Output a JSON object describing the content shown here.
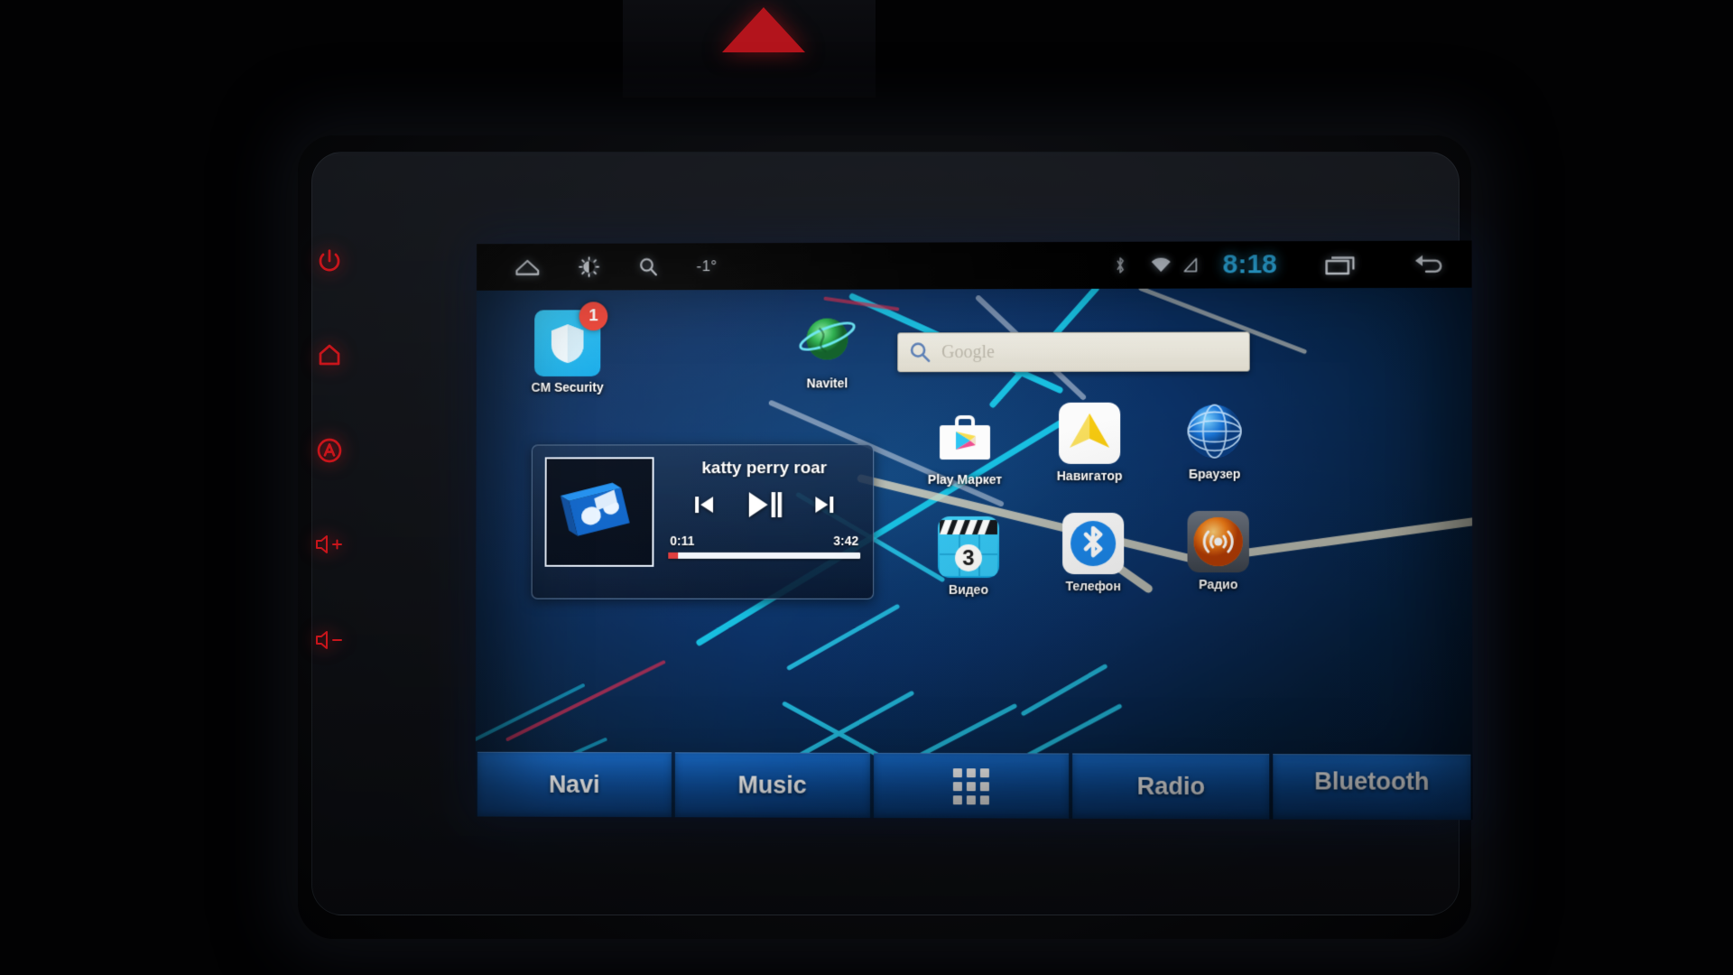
{
  "device": {
    "type": "android-car-head-unit",
    "side_keys": [
      {
        "name": "power-key",
        "glyph": "power"
      },
      {
        "name": "home-key",
        "glyph": "home"
      },
      {
        "name": "mode-key",
        "glyph": "mode-a"
      },
      {
        "name": "volume-up-key",
        "glyph": "volume-up",
        "label": "+"
      },
      {
        "name": "volume-down-key",
        "glyph": "volume-down",
        "label": "-"
      }
    ]
  },
  "status_bar": {
    "home_icon": "home-icon",
    "brightness_icon": "brightness-icon",
    "search_icon": "search-icon",
    "temperature": "-1°",
    "bluetooth_icon": "bluetooth-icon",
    "wifi_icon": "wifi-icon",
    "signal_icon": "signal-icon",
    "clock": "8:18",
    "clock_color": "#2fb6ef",
    "recents_icon": "recent-apps-icon",
    "back_icon": "back-icon"
  },
  "search": {
    "placeholder": "Google",
    "icon": "magnifier-icon"
  },
  "apps_top": [
    {
      "label": "CM Security",
      "icon": "shield-icon",
      "badge": "1",
      "badge_color": "#ef3f32"
    },
    {
      "label": "Navitel",
      "icon": "globe-icon"
    }
  ],
  "apps_grid": [
    {
      "label": "Play Маркет",
      "icon": "play-store-icon"
    },
    {
      "label": "Навигатор",
      "icon": "navigator-arrow-icon"
    },
    {
      "label": "Браузер",
      "icon": "browser-globe-icon"
    },
    {
      "label": "Видео",
      "icon": "video-clapperboard-icon",
      "badge": "3"
    },
    {
      "label": "Телефон",
      "icon": "bluetooth-phone-icon"
    },
    {
      "label": "Радио",
      "icon": "radio-tower-icon"
    }
  ],
  "music_widget": {
    "track_title": "katty perry roar",
    "elapsed": "0:11",
    "duration": "3:42",
    "progress_percent": 5,
    "progress_color": "#e03b3b",
    "album_icon": "music-album-icon",
    "prev_icon": "previous-track-icon",
    "play_pause_icon": "play-pause-icon",
    "next_icon": "next-track-icon"
  },
  "dock": [
    {
      "label": "Navi",
      "name": "dock-navi"
    },
    {
      "label": "Music",
      "name": "dock-music"
    },
    {
      "label": "",
      "name": "dock-apps",
      "icon": "apps-grid-icon"
    },
    {
      "label": "Radio",
      "name": "dock-radio"
    },
    {
      "label": "Bluetooth",
      "name": "dock-bluetooth"
    }
  ]
}
